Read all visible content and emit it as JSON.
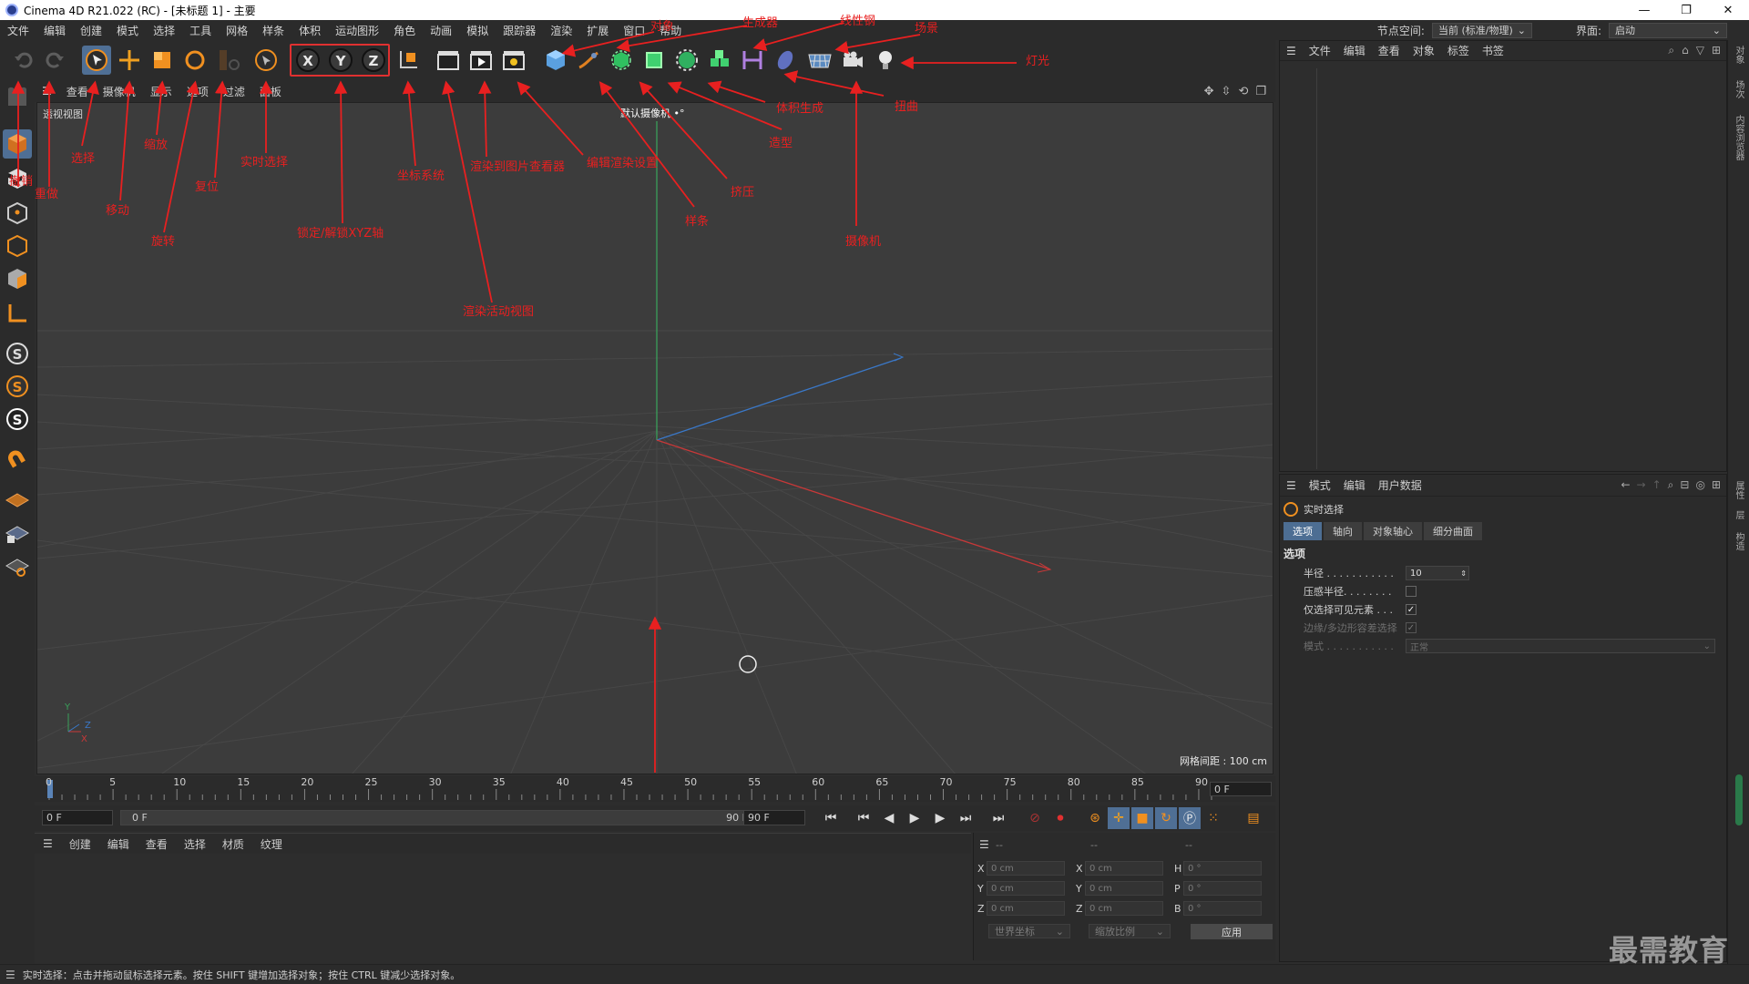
{
  "window": {
    "title": "Cinema 4D R21.022 (RC) - [未标题 1] - 主要",
    "minimize": "—",
    "restore": "❐",
    "close": "✕"
  },
  "menubar": {
    "items": [
      "文件",
      "编辑",
      "创建",
      "模式",
      "选择",
      "工具",
      "网格",
      "样条",
      "体积",
      "运动图形",
      "角色",
      "动画",
      "模拟",
      "跟踪器",
      "渲染",
      "扩展",
      "窗口",
      "帮助"
    ],
    "node_space_label": "节点空间:",
    "node_space_value": "当前 (标准/物理)",
    "layout_label": "界面:",
    "layout_value": "启动"
  },
  "viewport_menu": {
    "items": [
      "查看",
      "摄像机",
      "显示",
      "选项",
      "过滤",
      "面板"
    ]
  },
  "viewport": {
    "name": "透视视图",
    "camera": "默认摄像机 •°",
    "grid_spacing": "网格间距 : 100 cm"
  },
  "annotations": {
    "object": "对象",
    "generator": "生成器",
    "spline_pen": "线性钢",
    "scene": "场景",
    "light": "灯光",
    "undo": "撤销",
    "redo": "重做",
    "select": "选择",
    "move": "移动",
    "scale": "缩放",
    "rotate": "旋转",
    "reset": "复位",
    "live_select": "实时选择",
    "lock_xyz": "锁定/解锁XYZ轴",
    "coord_system": "坐标系统",
    "render_view": "渲染活动视图",
    "render_pic": "渲染到图片查看器",
    "edit_render": "编辑渲染设置",
    "spline": "样条",
    "extrude": "挤压",
    "modeling": "造型",
    "volume": "体积生成",
    "deform": "扭曲",
    "camera": "摄像机"
  },
  "timeline": {
    "ticks": [
      "0",
      "5",
      "10",
      "15",
      "20",
      "25",
      "30",
      "35",
      "40",
      "45",
      "50",
      "55",
      "60",
      "65",
      "70",
      "75",
      "80",
      "85",
      "90"
    ],
    "current_frame": "0 F",
    "start": "0 F",
    "range_start": "0 F",
    "range_end": "90 F",
    "end": "90 F"
  },
  "material_menu": {
    "items": [
      "创建",
      "编辑",
      "查看",
      "选择",
      "材质",
      "纹理"
    ]
  },
  "coordinates": {
    "headers": [
      "--",
      "--",
      "--"
    ],
    "rows": [
      {
        "a1": "X",
        "v1": "0 cm",
        "a2": "X",
        "v2": "0 cm",
        "a3": "H",
        "v3": "0 °"
      },
      {
        "a1": "Y",
        "v1": "0 cm",
        "a2": "Y",
        "v2": "0 cm",
        "a3": "P",
        "v3": "0 °"
      },
      {
        "a1": "Z",
        "v1": "0 cm",
        "a2": "Z",
        "v2": "0 cm",
        "a3": "B",
        "v3": "0 °"
      }
    ],
    "world_coord": "世界坐标",
    "scale_ratio": "缩放比例",
    "apply": "应用"
  },
  "object_manager": {
    "items": [
      "文件",
      "编辑",
      "查看",
      "对象",
      "标签",
      "书签"
    ]
  },
  "attributes": {
    "menu": [
      "模式",
      "编辑",
      "用户数据"
    ],
    "tool_name": "实时选择",
    "tabs": [
      "选项",
      "轴向",
      "对象轴心",
      "细分曲面"
    ],
    "section": "选项",
    "radius_label": "半径 . . . . . . . . . . .",
    "radius_value": "10",
    "pressure_label": "压感半径. . . . . . . .",
    "visible_label": "仅选择可见元素 . . .",
    "edge_label": "边缘/多边形容差选择",
    "mode_label": "模式 . . . . . . . . . . .",
    "mode_value": "正常"
  },
  "right_tabs": [
    "对象",
    "场次",
    "内容浏览器",
    "属性",
    "层",
    "构造"
  ],
  "status": "实时选择：点击并拖动鼠标选择元素。按住 SHIFT 键增加选择对象；按住 CTRL 键减少选择对象。",
  "watermark": "最需教育"
}
